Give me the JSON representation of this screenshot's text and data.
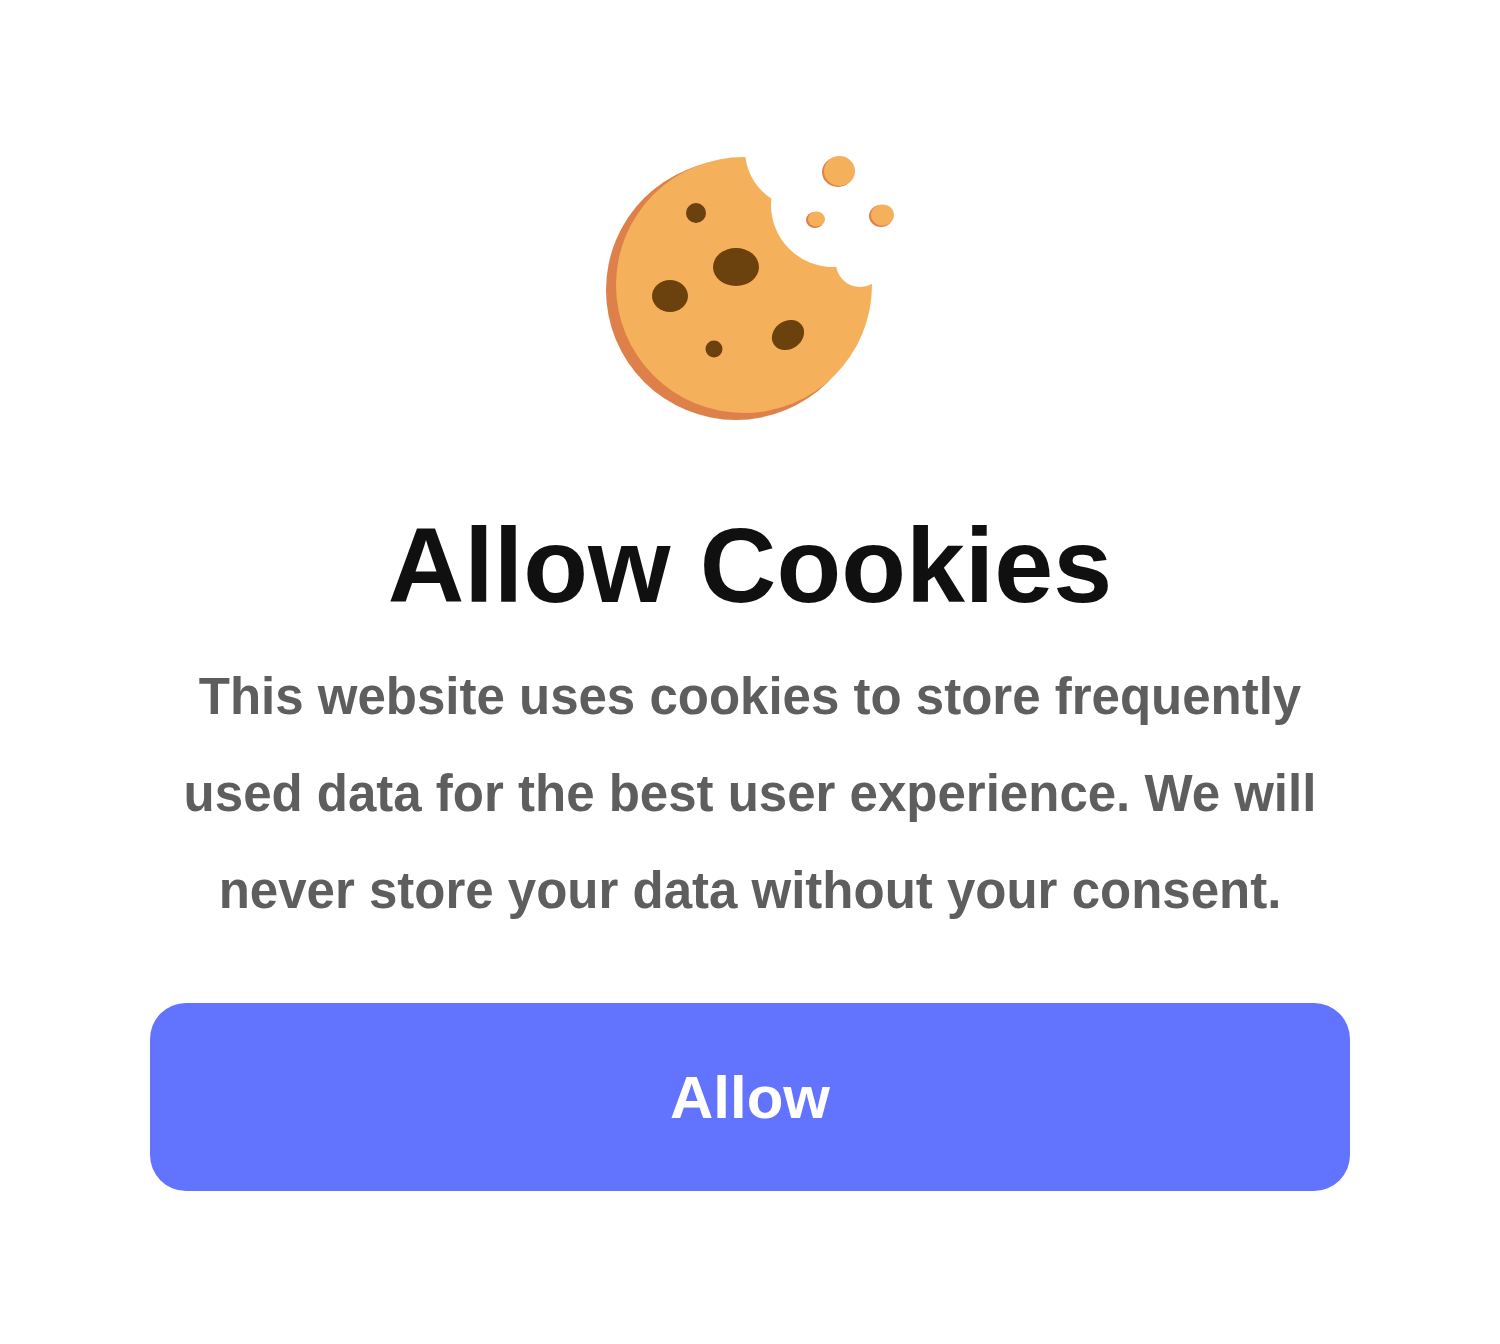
{
  "dialog": {
    "title": "Allow Cookies",
    "message": "This website uses cookies to store frequently used data for the best user experience. We will never store your data without your consent.",
    "buttons": [
      {
        "label": "Allow",
        "kind": "primary"
      }
    ]
  }
}
